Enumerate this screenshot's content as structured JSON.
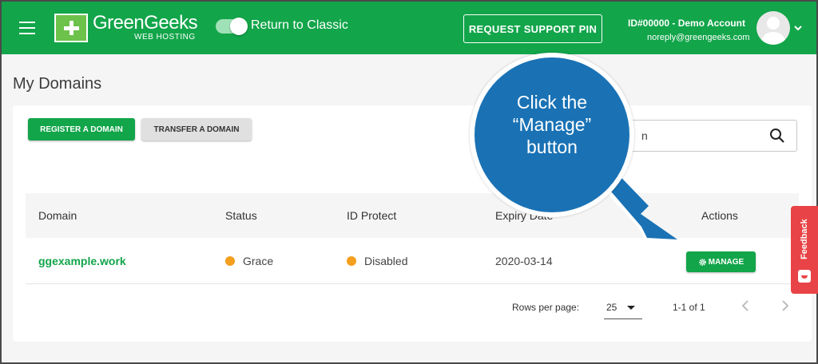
{
  "header": {
    "logo_name": "GreenGeeks",
    "logo_tagline": "WEB HOSTING",
    "toggle_label": "Return to Classic",
    "support_pin_button": "REQUEST SUPPORT PIN",
    "account_id": "ID#00000 - ",
    "account_name": "Demo Account",
    "account_email": "noreply@greengeeks.com"
  },
  "page": {
    "title": "My Domains",
    "register_button": "REGISTER A DOMAIN",
    "transfer_button": "TRANSFER A DOMAIN",
    "search_partial": "n"
  },
  "table": {
    "headers": [
      "Domain",
      "Status",
      "ID Protect",
      "Expiry Date",
      "Actions"
    ],
    "rows": [
      {
        "domain": "ggexample.work",
        "status": "Grace",
        "id_protect": "Disabled",
        "expiry": "2020-03-14",
        "action": "MANAGE"
      }
    ]
  },
  "pagination": {
    "rows_label": "Rows per page:",
    "rows_value": "25",
    "range": "1-1 of 1"
  },
  "callout": {
    "line1": "Click the",
    "line2": "“Manage”",
    "line3": "button"
  },
  "feedback": {
    "label": "Feedback"
  },
  "colors": {
    "brand_green": "#12a54a",
    "status_orange": "#f49f1e",
    "callout_blue": "#1a72b5",
    "feedback_red": "#e84346"
  },
  "icons": [
    "hamburger-icon",
    "logo-plus-icon",
    "toggle-switch",
    "avatar-icon",
    "chevron-down-icon",
    "search-icon",
    "gear-icon",
    "chevron-left-icon",
    "chevron-right-icon",
    "caret-down-icon",
    "feedback-smile-icon"
  ]
}
